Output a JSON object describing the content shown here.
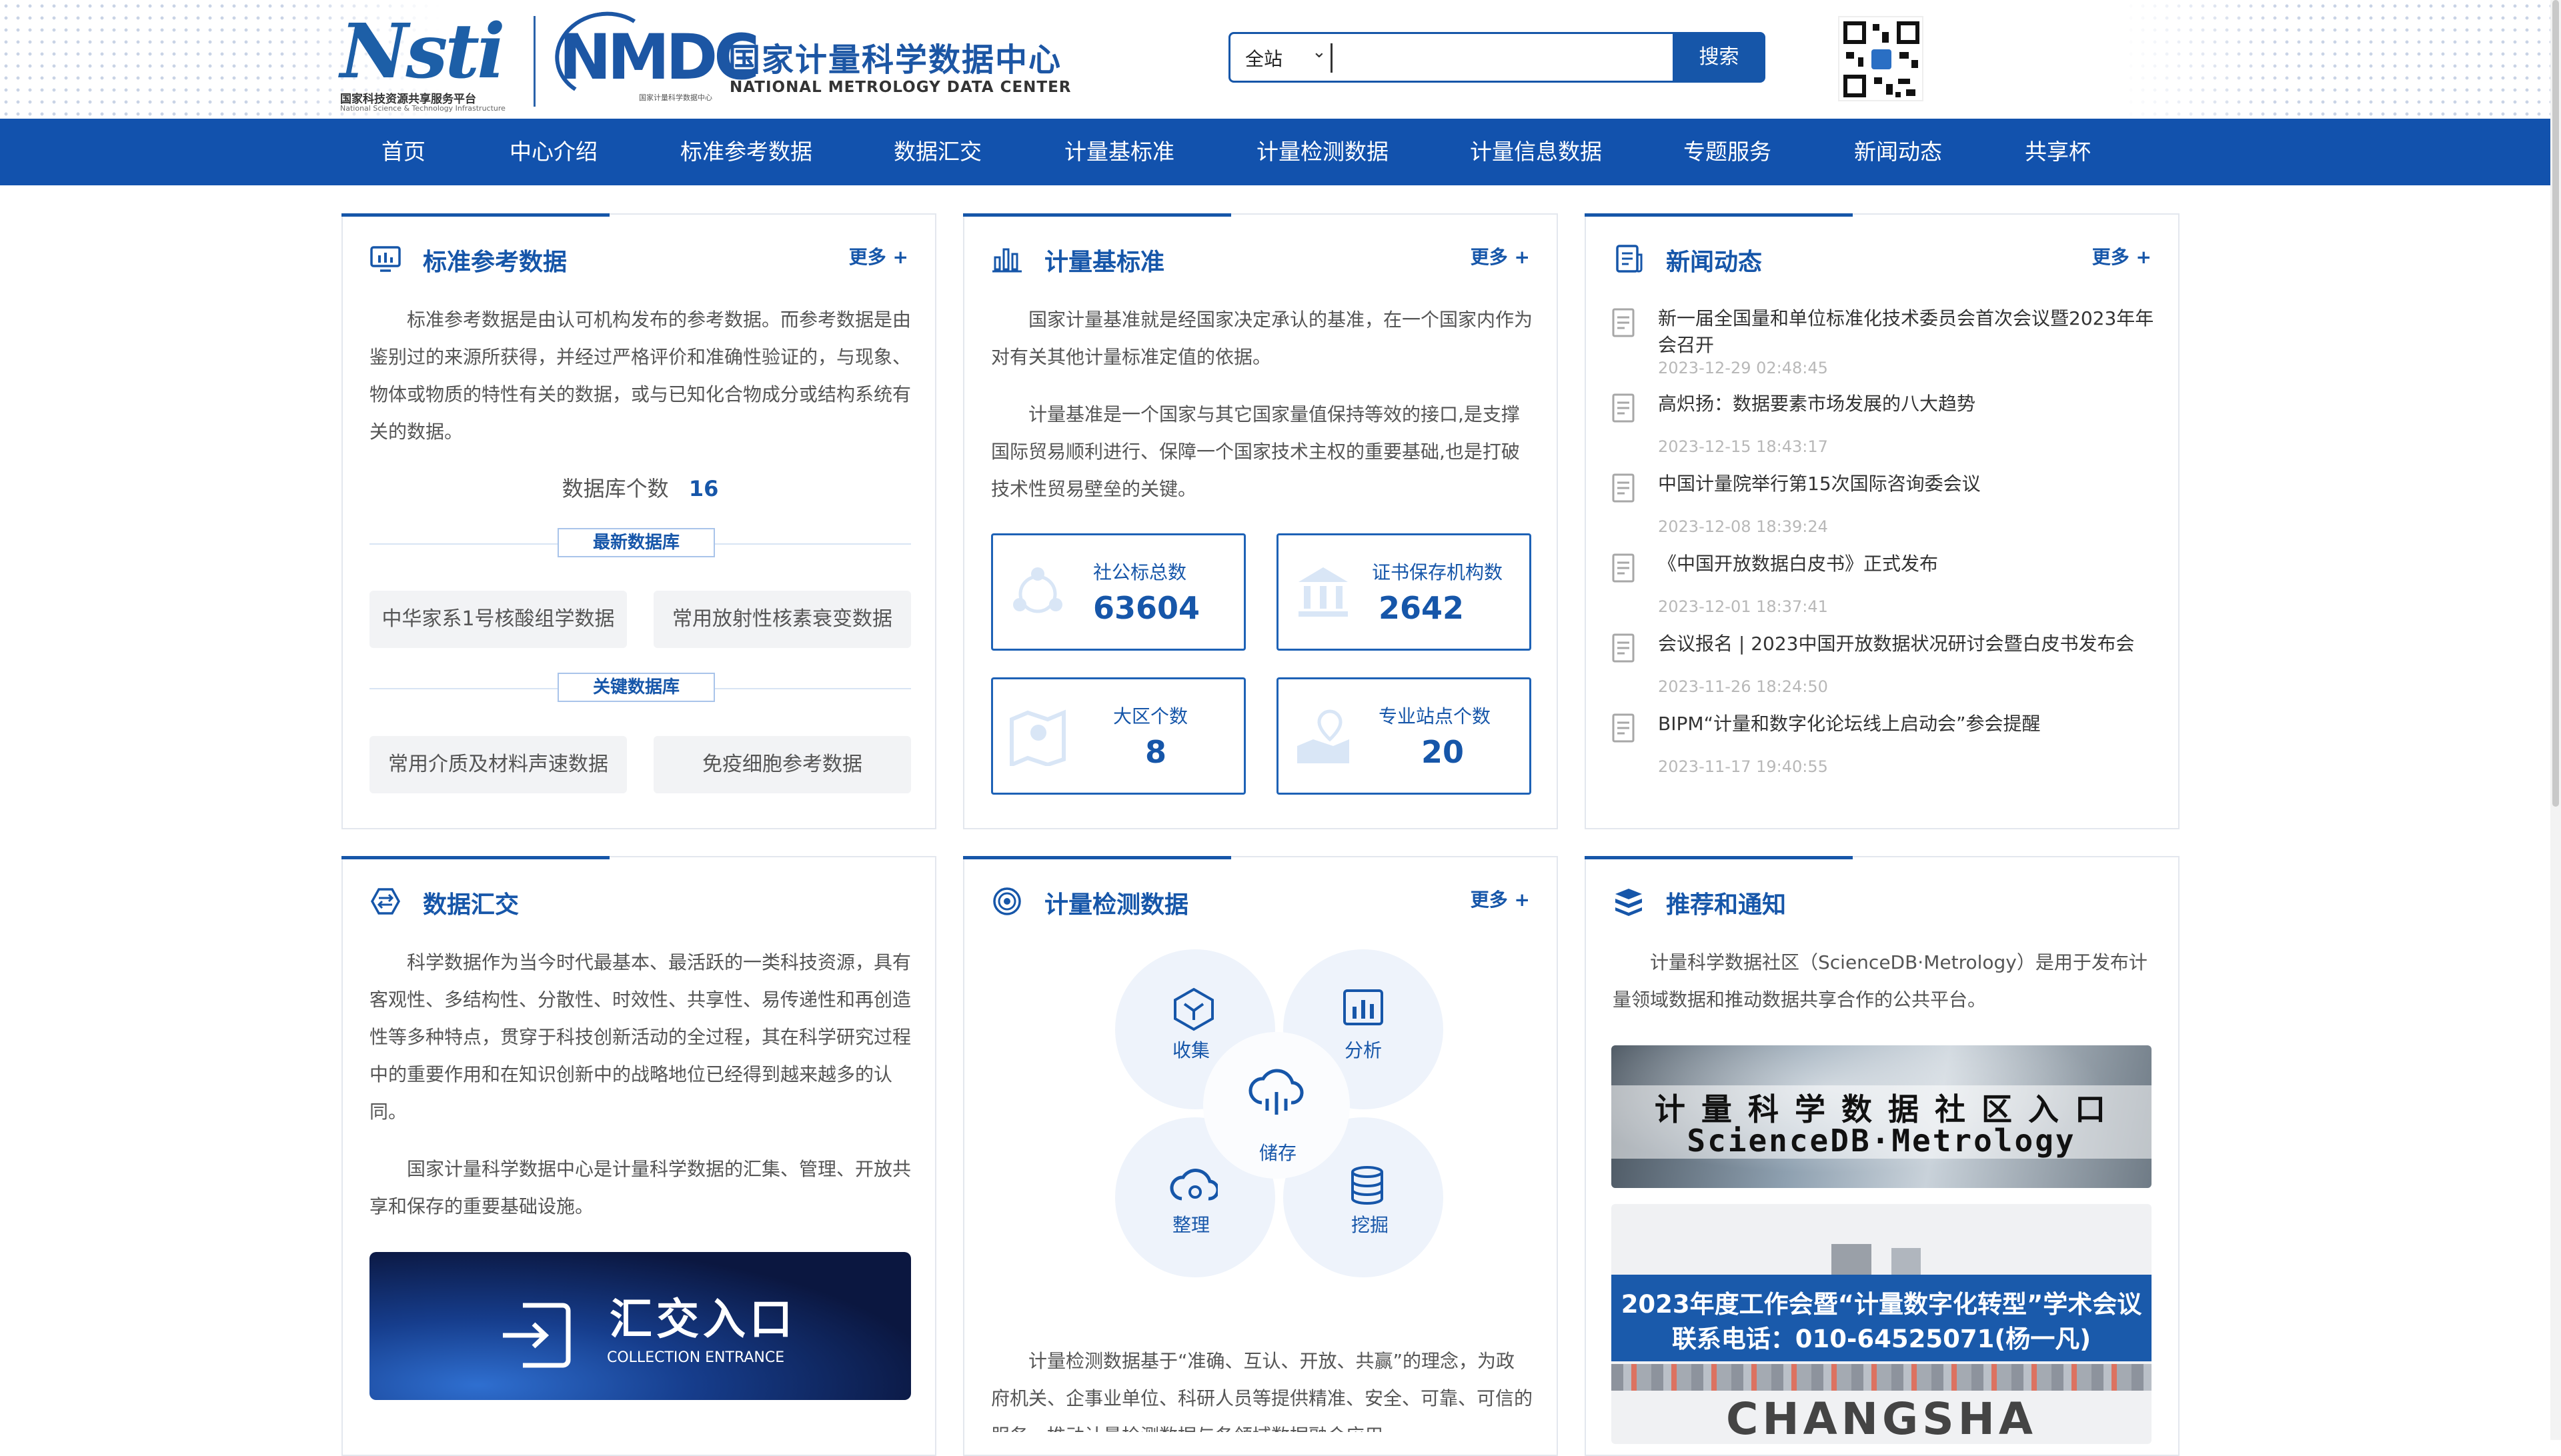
{
  "header": {
    "logo_nsti": {
      "mark": "Nsti",
      "cn": "国家科技资源共享服务平台",
      "en": "National Science & Technology Infrastructure"
    },
    "logo_nmdc": {
      "mark": "NMDC",
      "tiny": "国家计量科学数据中心"
    },
    "center_name_cn": "国家计量科学数据中心",
    "center_name_en": "NATIONAL METROLOGY DATA CENTER",
    "search": {
      "scope": "全站",
      "placeholder": "",
      "button": "搜索"
    }
  },
  "nav": [
    "首页",
    "中心介绍",
    "标准参考数据",
    "数据汇交",
    "计量基标准",
    "计量检测数据",
    "计量信息数据",
    "专题服务",
    "新闻动态",
    "共享杯"
  ],
  "panels": {
    "std_ref": {
      "title": "标准参考数据",
      "more": "更多 +",
      "desc": "标准参考数据是由认可机构发布的参考数据。而参考数据是由鉴别过的来源所获得，并经过严格评价和准确性验证的，与现象、物体或物质的特性有关的数据，或与已知化合物成分或结构系统有关的数据。",
      "db_count_label": "数据库个数",
      "db_count": "16",
      "latest_label": "最新数据库",
      "latest": [
        "中华家系1号核酸组学数据",
        "常用放射性核素衰变数据"
      ],
      "key_label": "关键数据库",
      "key": [
        "常用介质及材料声速数据",
        "免疫细胞参考数据"
      ]
    },
    "measure_std": {
      "title": "计量基标准",
      "more": "更多 +",
      "desc1": "国家计量基准就是经国家决定承认的基准，在一个国家内作为对有关其他计量标准定值的依据。",
      "desc2": "计量基准是一个国家与其它国家量值保持等效的接口,是支撑国际贸易顺利进行、保障一个国家技术主权的重要基础,也是打破技术性贸易壁垒的关键。",
      "stats": [
        {
          "label": "社公标总数",
          "value": "63604"
        },
        {
          "label": "证书保存机构数",
          "value": "2642"
        },
        {
          "label": "大区个数",
          "value": "8"
        },
        {
          "label": "专业站点个数",
          "value": "20"
        }
      ]
    },
    "news": {
      "title": "新闻动态",
      "more": "更多 +",
      "items": [
        {
          "title": "新一届全国量和单位标准化技术委员会首次会议暨2023年年会召开",
          "date": "2023-12-29 02:48:45"
        },
        {
          "title": "高炽扬：数据要素市场发展的八大趋势",
          "date": "2023-12-15 18:43:17"
        },
        {
          "title": "中国计量院举行第15次国际咨询委会议",
          "date": "2023-12-08 18:39:24"
        },
        {
          "title": "《中国开放数据白皮书》正式发布",
          "date": "2023-12-01 18:37:41"
        },
        {
          "title": "会议报名 | 2023中国开放数据状况研讨会暨白皮书发布会",
          "date": "2023-11-26 18:24:50"
        },
        {
          "title": "BIPM“计量和数字化论坛线上启动会”参会提醒",
          "date": "2023-11-17 19:40:55"
        }
      ]
    },
    "data_submit": {
      "title": "数据汇交",
      "desc1": "科学数据作为当今时代最基本、最活跃的一类科技资源，具有客观性、多结构性、分散性、时效性、共享性、易传递性和再创造性等多种特点，贯穿于科技创新活动的全过程，其在科学研究过程中的重要作用和在知识创新中的战略地位已经得到越来越多的认同。",
      "desc2": "国家计量科学数据中心是计量科学数据的汇集、管理、开放共享和保存的重要基础设施。",
      "entry_cn": "汇交入口",
      "entry_en": "COLLECTION ENTRANCE"
    },
    "measure_test": {
      "title": "计量检测数据",
      "more": "更多 +",
      "circles": [
        "收集",
        "分析",
        "储存",
        "整理",
        "挖掘"
      ],
      "desc": "计量检测数据基于“准确、互认、开放、共赢”的理念，为政府机关、企事业单位、科研人员等提供精准、安全、可靠、可信的服务，推动计量检测数据与各领域数据融合应用。"
    },
    "recommend": {
      "title": "推荐和通知",
      "desc": "计量科学数据社区（ScienceDB·Metrology）是用于发布计量领域数据和推动数据共享合作的公共平台。",
      "banner1_cn": "计 量 科 学 数 据 社 区 入 口",
      "banner1_en": "ScienceDB·Metrology",
      "banner2_line1": "2023年度工作会暨“计量数字化转型”学术会议",
      "banner2_line2": "联系电话：010-64525071(杨一凡)",
      "banner2_city": "CHANGSHA"
    }
  },
  "colors": {
    "primary": "#1656a9",
    "nav_bg": "#1252ad",
    "border": "#e3e7ee"
  }
}
